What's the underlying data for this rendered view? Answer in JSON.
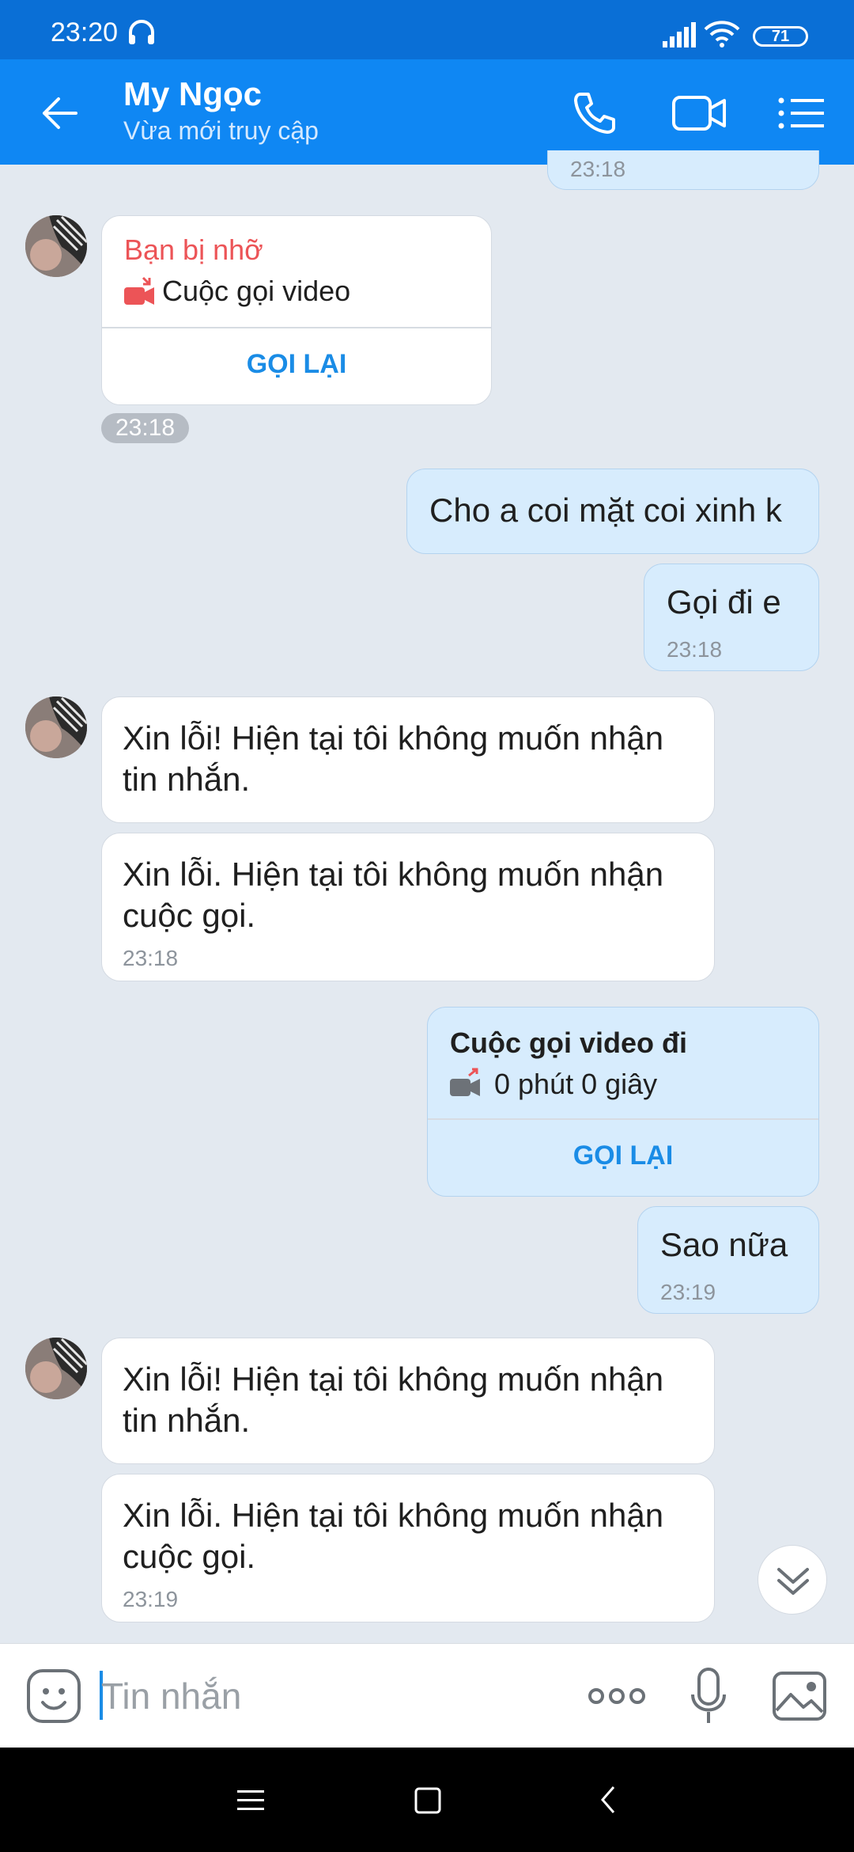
{
  "status_bar": {
    "time": "23:20",
    "battery": "71"
  },
  "header": {
    "contact_name": "My Ngọc",
    "status": "Vừa mới truy cập"
  },
  "messages": {
    "clipped_time": "23:18",
    "missed_call": {
      "title": "Bạn bị nhỡ",
      "label": "Cuộc gọi video",
      "action": "GỌI LẠI",
      "time": "23:18"
    },
    "out1": {
      "text": "Cho a coi mặt coi xinh k"
    },
    "out2": {
      "text": "Gọi đi e",
      "time": "23:18"
    },
    "in1": {
      "text": "Xin lỗi! Hiện tại tôi không muốn nhận\ntin nhắn."
    },
    "in2": {
      "text": "Xin lỗi. Hiện tại tôi không muốn nhận\ncuộc gọi.",
      "time": "23:18"
    },
    "outgoing_call": {
      "title": "Cuộc gọi video đi",
      "label": "0 phút 0 giây",
      "action": "GỌI LẠI"
    },
    "out3": {
      "text": "Sao nữa",
      "time": "23:19"
    },
    "in3": {
      "text": "Xin lỗi! Hiện tại tôi không muốn nhận\ntin nhắn."
    },
    "in4": {
      "text": "Xin lỗi. Hiện tại tôi không muốn nhận\ncuộc gọi.",
      "time": "23:19"
    }
  },
  "composer": {
    "placeholder": "Tin nhắn"
  },
  "colors": {
    "header": "#0f87f3",
    "status_bar": "#0a6fd6",
    "accent": "#1a8ce6",
    "missed": "#ec5457",
    "outgoing_bubble": "#d7ecfd"
  },
  "icons": [
    "headset-icon",
    "signal-icon",
    "wifi-icon",
    "back-arrow-icon",
    "phone-icon",
    "video-icon",
    "menu-list-icon",
    "missed-video-call-icon",
    "outgoing-video-call-icon",
    "scroll-down-icon",
    "sticker-icon",
    "more-icon",
    "microphone-icon",
    "image-icon",
    "nav-menu-icon",
    "nav-home-icon",
    "nav-back-icon"
  ]
}
